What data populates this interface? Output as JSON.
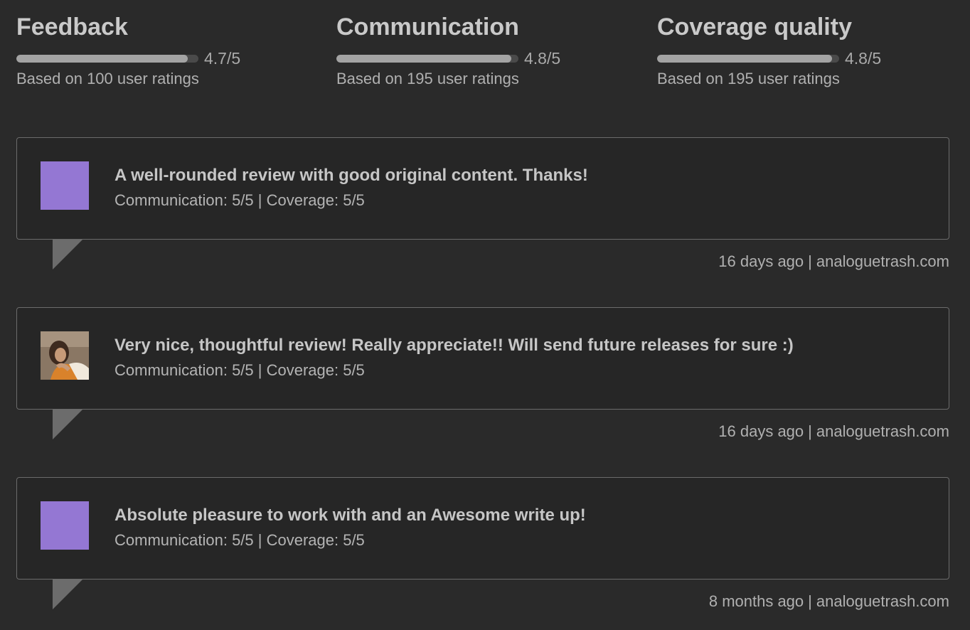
{
  "stats": [
    {
      "title": "Feedback",
      "score": "4.7/5",
      "fill": 0.94,
      "count": "Based on 100 user ratings"
    },
    {
      "title": "Communication",
      "score": "4.8/5",
      "fill": 0.96,
      "count": "Based on 195 user ratings"
    },
    {
      "title": "Coverage quality",
      "score": "4.8/5",
      "fill": 0.96,
      "count": "Based on 195 user ratings"
    }
  ],
  "reviews": [
    {
      "avatar": "purple-square",
      "quote": "A well-rounded review with good original content. Thanks!",
      "scores": "Communication: 5/5 | Coverage: 5/5",
      "time": "16 days ago",
      "site": "analoguetrash.com"
    },
    {
      "avatar": "photo",
      "quote": "Very nice, thoughtful review! Really appreciate!! Will send future releases for sure :)",
      "scores": "Communication: 5/5 | Coverage: 5/5",
      "time": "16 days ago",
      "site": "analoguetrash.com"
    },
    {
      "avatar": "purple-square",
      "quote": "Absolute pleasure to work with and an Awesome write up!",
      "scores": "Communication: 5/5 | Coverage: 5/5",
      "time": "8 months ago",
      "site": "analoguetrash.com"
    }
  ],
  "colors": {
    "background": "#2a2a2a",
    "bar_fill": "#a3a3a3",
    "bar_track": "#4a4a4a",
    "avatar_purple": "#9477d3",
    "card_border": "#6b6b6b"
  },
  "separator": "|"
}
